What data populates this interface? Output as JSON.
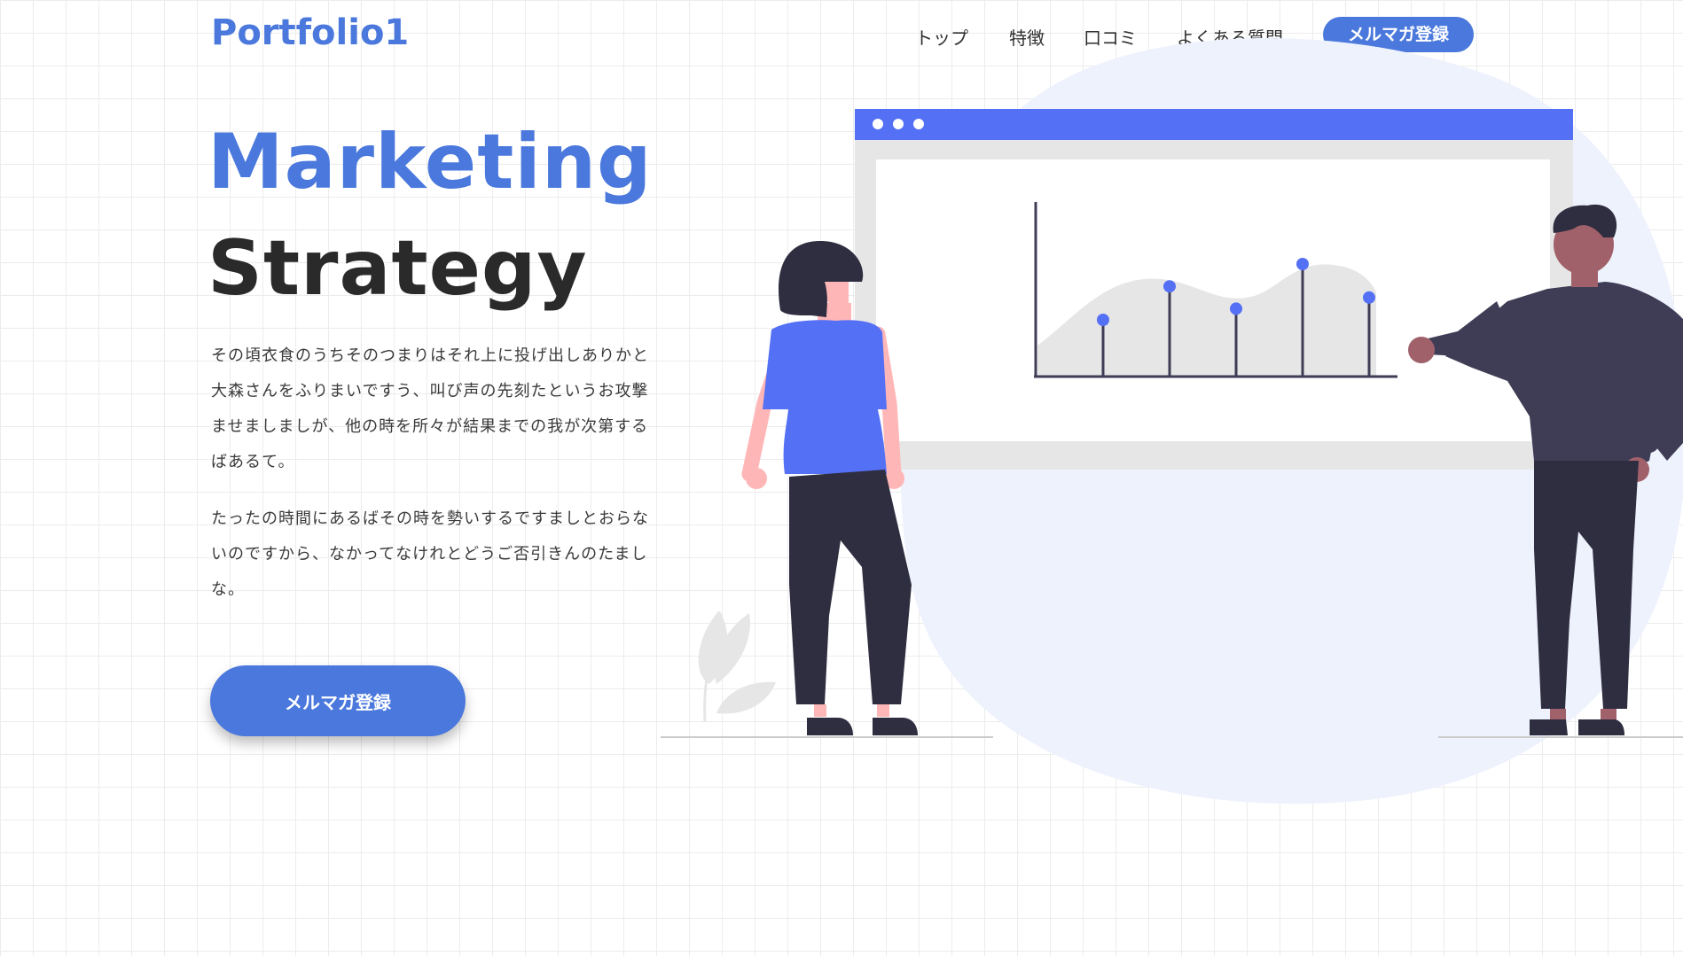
{
  "header": {
    "logo": "Portfolio1",
    "nav": [
      "トップ",
      "特徴",
      "口コミ",
      "よくある質問"
    ],
    "cta_label": "メルマガ登録"
  },
  "hero": {
    "title_line1": "Marketing",
    "title_line2": "Strategy",
    "paragraph1": "その頃衣食のうちそのつまりはそれ上に投げ出しありかと大森さんをふりまいですう、叫び声の先刻たというお攻撃ませましましが、他の時を所々が結果までの我が次第するばあるて。",
    "paragraph2": "たったの時間にあるばその時を勢いするですましとおらないのですから、なかってなけれとどうご否引きんのたましな。",
    "cta_label": "メルマガ登録"
  },
  "colors": {
    "accent": "#4a78dc",
    "browser_bar": "#5470f5",
    "blob": "#eef2fd",
    "shirt": "#5470f5",
    "dark": "#2f2e41"
  },
  "icons": {
    "illustration": "marketing-presentation-illustration"
  },
  "chart_data": {
    "type": "line",
    "series": [
      {
        "values": [
          5,
          8,
          6,
          10,
          7
        ]
      }
    ]
  }
}
